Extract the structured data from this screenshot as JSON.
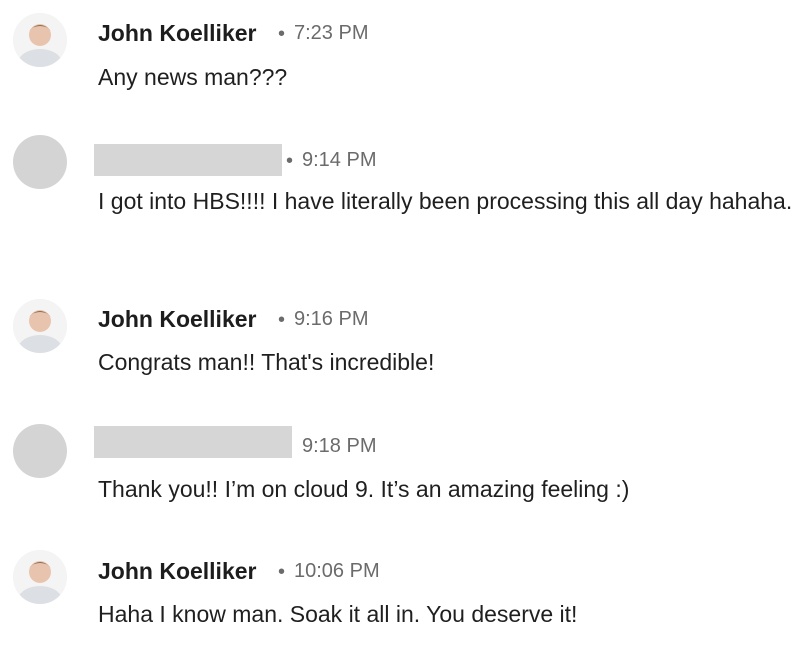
{
  "messages": [
    {
      "sender": "John Koelliker",
      "separator": "•",
      "time": "7:23 PM",
      "text": "Any news man???",
      "avatar": "profile-photo"
    },
    {
      "sender": "",
      "separator": "•",
      "time": "9:14 PM",
      "text": "I got into HBS!!!! I have literally been processing this all day hahaha.",
      "avatar": "blank-placeholder"
    },
    {
      "sender": "John Koelliker",
      "separator": "•",
      "time": "9:16 PM",
      "text": "Congrats man!! That's incredible!",
      "avatar": "profile-photo"
    },
    {
      "sender": "",
      "separator": "",
      "time": "9:18 PM",
      "text": "Thank you!! I’m on cloud 9. It’s an amazing feeling :)",
      "avatar": "blank-placeholder"
    },
    {
      "sender": "John Koelliker",
      "separator": "•",
      "time": "10:06 PM",
      "text": "Haha I know man. Soak it all in. You deserve it!",
      "avatar": "profile-photo"
    }
  ],
  "colors": {
    "redaction": "#d6d6d6",
    "meta_text": "#6b6b6b",
    "body_text": "#1f1f1f"
  }
}
